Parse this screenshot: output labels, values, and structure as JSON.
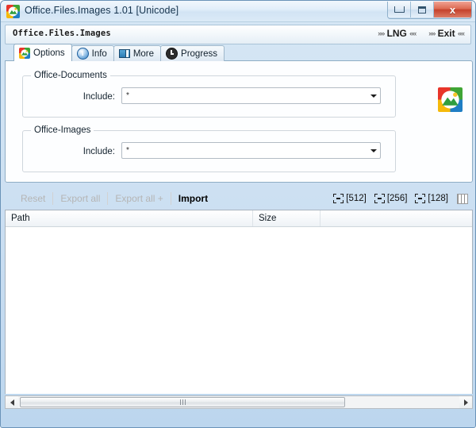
{
  "window": {
    "title": "Office.Files.Images 1.01 [Unicode]",
    "icon": "app-logo-icon",
    "controls": {
      "minimize": "minimize-button",
      "maximize": "maximize-button",
      "close_label": "x"
    }
  },
  "menubar": {
    "app_name": "Office.Files.Images",
    "links": [
      {
        "name": "lng",
        "prefix": "»»",
        "label": "LNG",
        "suffix": "««"
      },
      {
        "name": "exit",
        "prefix": "»»",
        "label": "Exit",
        "suffix": "««"
      }
    ]
  },
  "tabs": [
    {
      "label": "Options",
      "icon": "app-logo-icon",
      "active": true
    },
    {
      "label": "Info",
      "icon": "info-icon",
      "active": false
    },
    {
      "label": "More",
      "icon": "window-icon",
      "active": false
    },
    {
      "label": "Progress",
      "icon": "clock-icon",
      "active": false
    }
  ],
  "options_panel": {
    "groups": [
      {
        "legend": "Office-Documents",
        "field_label": "Include:",
        "combo_value": "*",
        "combo_placeholder": "*"
      },
      {
        "legend": "Office-Images",
        "field_label": "Include:",
        "combo_value": "*",
        "combo_placeholder": "*"
      }
    ],
    "logo_icon": "app-logo-icon"
  },
  "toolbar": {
    "buttons": [
      {
        "label": "Reset",
        "enabled": false
      },
      {
        "label": "Export all",
        "enabled": false
      },
      {
        "label": "Export all +",
        "enabled": false
      },
      {
        "label": "Import",
        "enabled": true
      }
    ],
    "size_buttons": [
      {
        "label": "[512]",
        "icon": "resize-icon"
      },
      {
        "label": "[256]",
        "icon": "resize-icon"
      },
      {
        "label": "[128]",
        "icon": "resize-icon"
      }
    ],
    "grid_button": {
      "icon": "grid-icon"
    }
  },
  "listview": {
    "columns": [
      {
        "label": "Path"
      },
      {
        "label": "Size"
      },
      {
        "label": ""
      }
    ],
    "rows": []
  },
  "scrollbar": {
    "left_arrow": "scroll-left-icon",
    "right_arrow": "scroll-right-icon",
    "grip": "scroll-thumb-grip"
  },
  "colors": {
    "frame": "#6a93b8",
    "titlebar_text": "#16344e",
    "close_button": "#c4422c",
    "disabled_text": "#b5b5b5",
    "enabled_text": "#000000",
    "panel_bg": "#fdfeff"
  }
}
